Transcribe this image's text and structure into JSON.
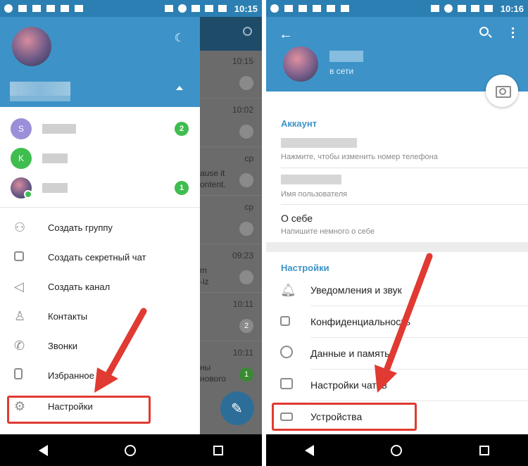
{
  "colors": {
    "header_blue": "#3d93c8",
    "highlight_red": "#e03a32",
    "badge_green": "#3fbd4e"
  },
  "left": {
    "status_time": "10:15",
    "drawer": {
      "accounts": [
        {
          "initial": "S",
          "color": "#9b8fd9",
          "badge": "2"
        },
        {
          "initial": "K",
          "color": "#3fbd4e",
          "badge": ""
        },
        {
          "initial": "",
          "color": "",
          "badge": "1"
        }
      ],
      "menu": [
        {
          "label": "Создать группу",
          "icon": "group-icon"
        },
        {
          "label": "Создать секретный чат",
          "icon": "lock-icon"
        },
        {
          "label": "Создать канал",
          "icon": "megaphone-icon"
        },
        {
          "label": "Контакты",
          "icon": "person-icon"
        },
        {
          "label": "Звонки",
          "icon": "phone-icon"
        },
        {
          "label": "Избранное",
          "icon": "bookmark-icon"
        },
        {
          "label": "Настройки",
          "icon": "gear-icon"
        }
      ]
    },
    "chats": [
      {
        "time": "10:15",
        "preview": "",
        "badge": ""
      },
      {
        "time": "10:02",
        "preview": "",
        "badge": ""
      },
      {
        "time": "ср",
        "preview": "ause it\nontent.",
        "badge": ""
      },
      {
        "time": "ср",
        "preview": "",
        "badge": ""
      },
      {
        "time": "09:23",
        "preview": "m\n-iz",
        "badge": ""
      },
      {
        "time": "10:11",
        "preview": "",
        "badge": "2"
      },
      {
        "time": "10:11",
        "preview": "ны\nнового",
        "badge": "1"
      }
    ]
  },
  "right": {
    "status_time": "10:16",
    "profile_status": "в сети",
    "account_section": "Аккаунт",
    "phone_hint": "Нажмите, чтобы изменить номер телефона",
    "username_hint": "Имя пользователя",
    "bio_label": "О себе",
    "bio_hint": "Напишите немного о себе",
    "settings_section": "Настройки",
    "settings": [
      {
        "label": "Уведомления и звук",
        "icon": "bell-icon"
      },
      {
        "label": "Конфиденциальность",
        "icon": "lock-icon"
      },
      {
        "label": "Данные и память",
        "icon": "pie-chart-icon"
      },
      {
        "label": "Настройки чатов",
        "icon": "chat-icon"
      },
      {
        "label": "Устройства",
        "icon": "laptop-icon"
      }
    ]
  }
}
